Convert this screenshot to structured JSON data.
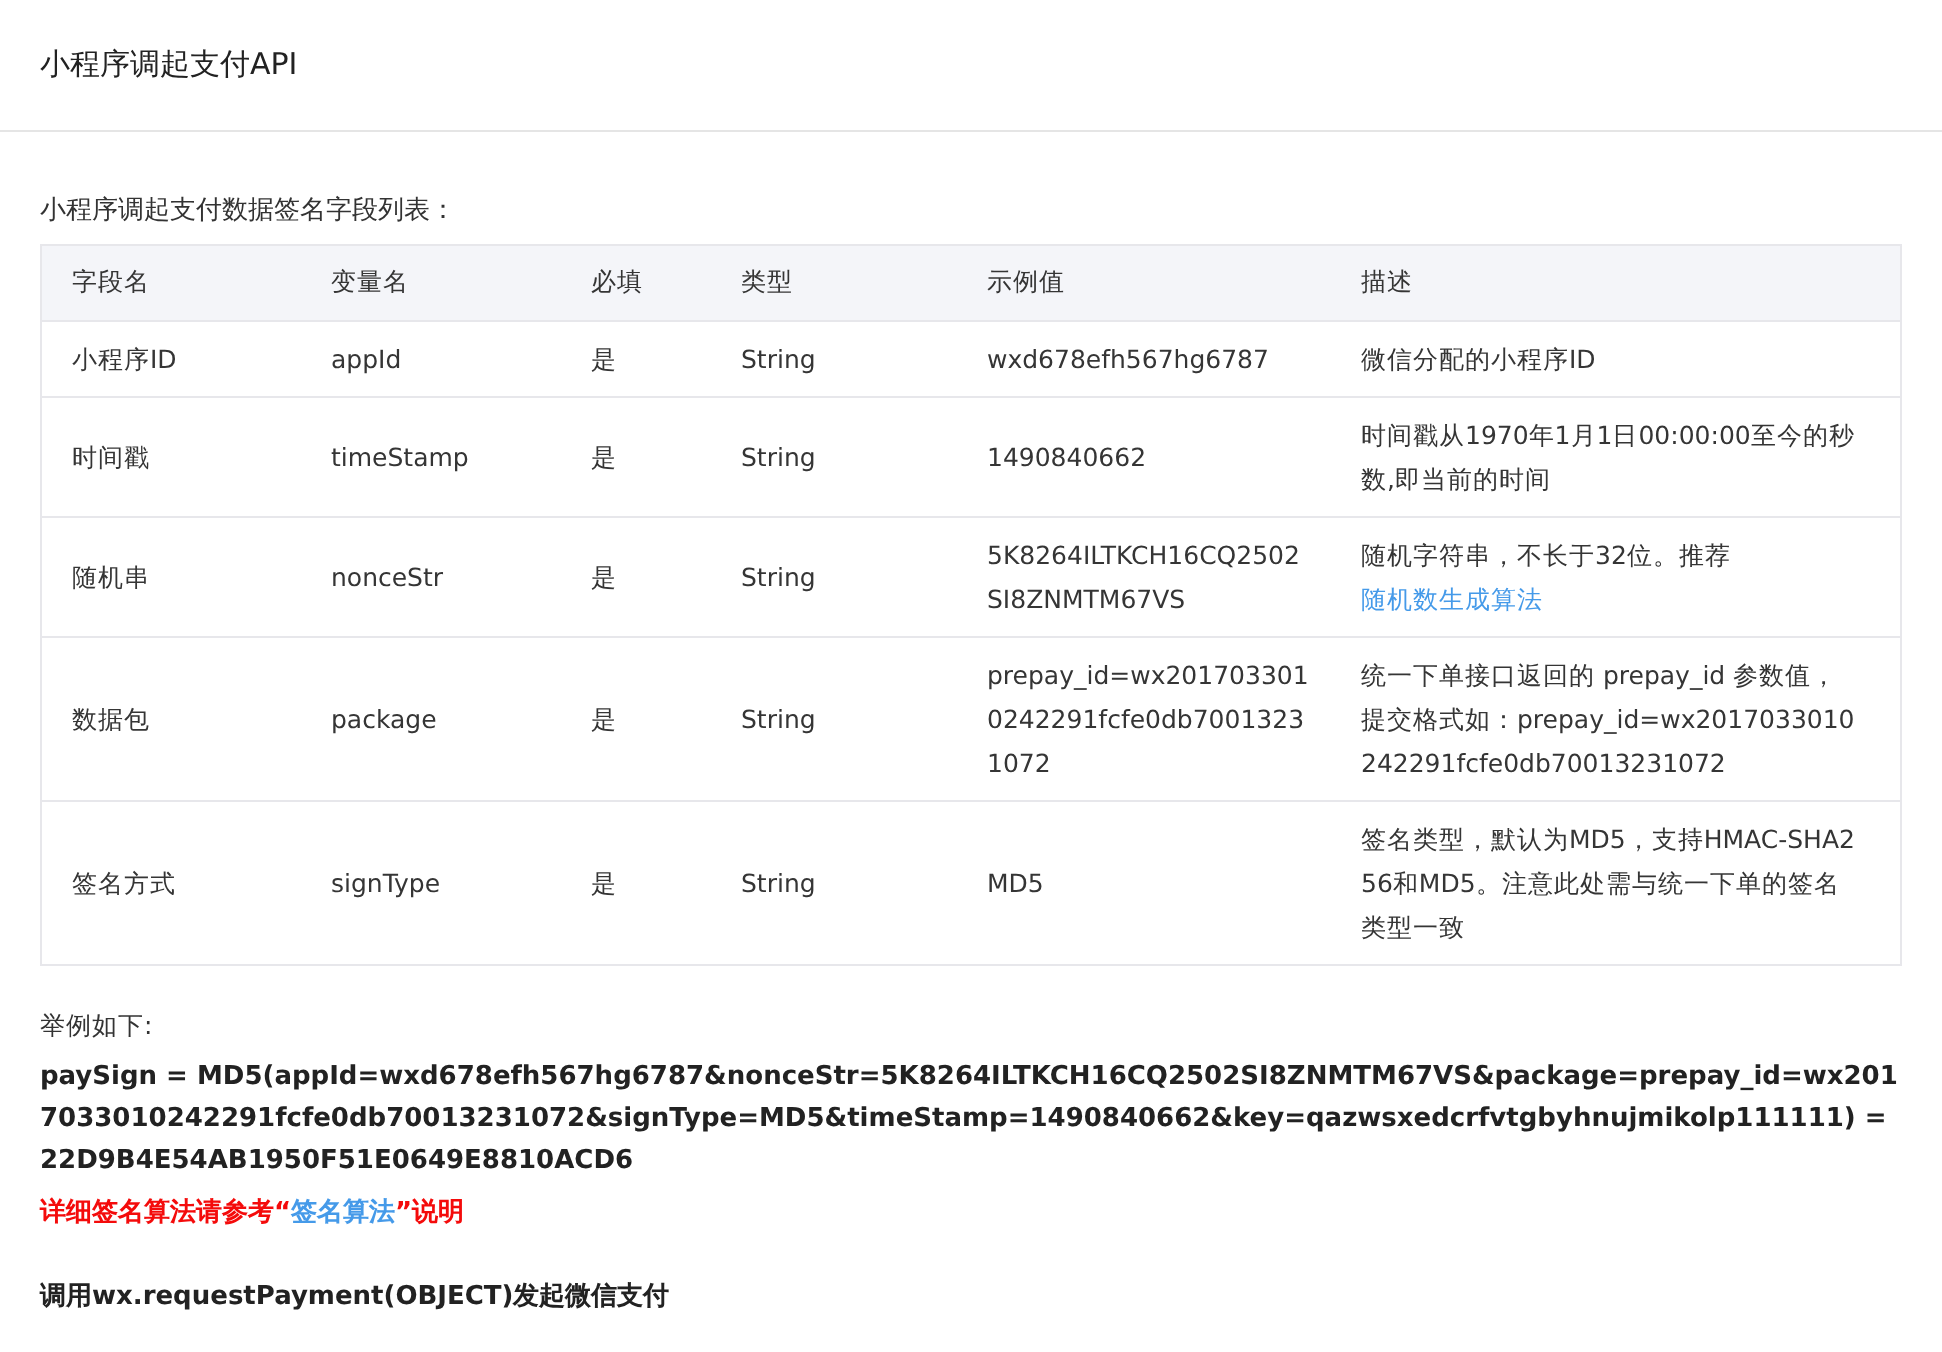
{
  "header": {
    "title": "小程序调起支付API"
  },
  "table_caption": "小程序调起支付数据签名字段列表：",
  "table": {
    "columns": [
      "字段名",
      "变量名",
      "必填",
      "类型",
      "示例值",
      "描述"
    ],
    "rows": [
      {
        "field": "小程序ID",
        "variable": "appId",
        "required": "是",
        "type": "String",
        "example": "wxd678efh567hg6787",
        "description": [
          {
            "text": "微信分配的小程序ID"
          }
        ]
      },
      {
        "field": "时间戳",
        "variable": "timeStamp",
        "required": "是",
        "type": "String",
        "example": "1490840662",
        "description": [
          {
            "text": "时间戳从1970年1月1日00:00:00至今的秒数,即当前的时间"
          }
        ]
      },
      {
        "field": "随机串",
        "variable": "nonceStr",
        "required": "是",
        "type": "String",
        "example": "5K8264ILTKCH16CQ2502SI8ZNMTM67VS",
        "description": [
          {
            "text": "随机字符串，不长于32位。推荐"
          },
          {
            "text": "随机数生成算法",
            "link": true
          }
        ]
      },
      {
        "field": "数据包",
        "variable": "package",
        "required": "是",
        "type": "String",
        "example": "prepay_id=wx2017033010242291fcfe0db70013231072",
        "description": [
          {
            "text": "统一下单接口返回的 prepay_id 参数值，提交格式如：prepay_id=wx2017033010242291fcfe0db70013231072"
          }
        ]
      },
      {
        "field": "签名方式",
        "variable": "signType",
        "required": "是",
        "type": "String",
        "example": "MD5",
        "description": [
          {
            "text": "签名类型，默认为MD5，支持HMAC-SHA256和MD5。注意此处需与统一下单的签名类型一致"
          }
        ]
      }
    ]
  },
  "example_label": "举例如下:",
  "pay_sign": "paySign = MD5(appId=wxd678efh567hg6787&nonceStr=5K8264ILTKCH16CQ2502SI8ZNMTM67VS&package=prepay_id=wx2017033010242291fcfe0db70013231072&signType=MD5&timeStamp=1490840662&key=qazwsxedcrfvtgbyhnujmikolp111111) = 22D9B4E54AB1950F51E0649E8810ACD6",
  "note": [
    {
      "text": "详细签名算法请参考“"
    },
    {
      "text": "签名算法",
      "link": true
    },
    {
      "text": "”说明"
    }
  ],
  "section_heading": "调用wx.requestPayment(OBJECT)发起微信支付"
}
